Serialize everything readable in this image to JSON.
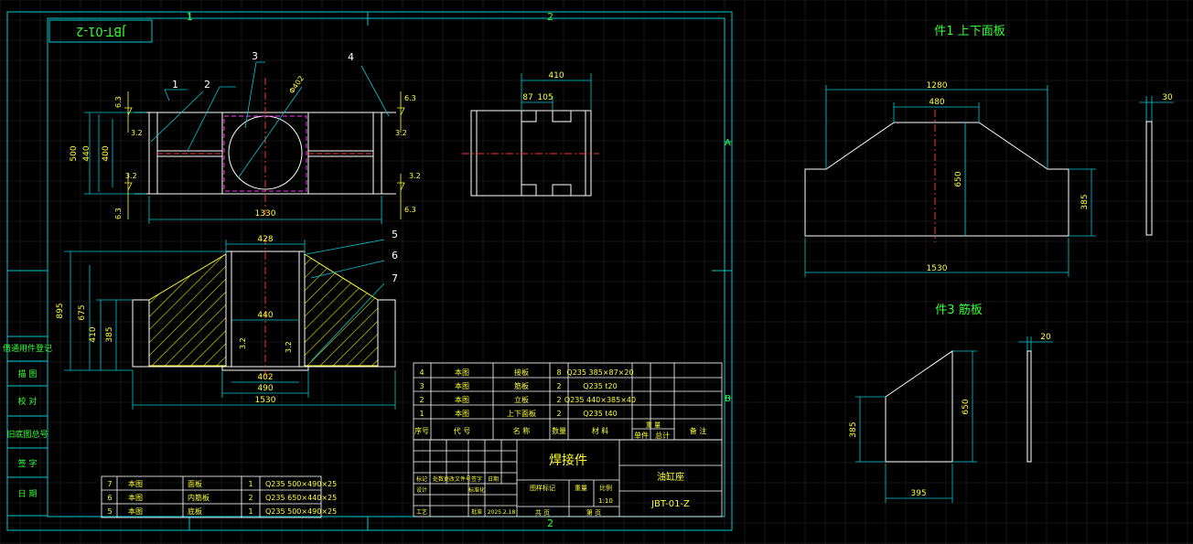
{
  "colors": {
    "background": "#000000",
    "grid": "#2a2a2a",
    "frame": "#00c8d6",
    "outline": "#ffffff",
    "text_green": "#33ff33",
    "text_yellow": "#ffff33",
    "hatch": "#e6e600",
    "centerline": "#ff3333",
    "magenta": "#ff33ff"
  },
  "sheet": {
    "zone_top_1": "1",
    "zone_top_2": "2",
    "zone_bottom_2": "2",
    "zone_right_a": "A",
    "zone_right_b": "B",
    "code_mirrored": "JBT-01-2"
  },
  "side_labels": [
    "借通用件登记",
    "描 图",
    "校 对",
    "旧底图总号",
    "签 字",
    "日 期"
  ],
  "top_view": {
    "dims": {
      "d500": "500",
      "d440": "440",
      "d400": "400",
      "d1330": "1330",
      "phi": "Φ402"
    },
    "weld_marks": [
      "6.3",
      "3.2",
      "3.2",
      "6.3",
      "6.3",
      "3.2",
      "3.2",
      "6.3"
    ],
    "callouts": [
      "1",
      "2",
      "3",
      "4"
    ]
  },
  "side_view": {
    "dims": {
      "d410": "410",
      "d87": "87",
      "d105": "105"
    }
  },
  "front_view": {
    "dims": {
      "d428": "428",
      "d895": "895",
      "d675": "675",
      "d410": "410",
      "d385": "385",
      "d440": "440",
      "d402": "402",
      "d490": "490",
      "d1530": "1530"
    },
    "weld_marks": [
      "3.2",
      "3.2"
    ],
    "callouts": [
      "5",
      "6",
      "7"
    ]
  },
  "part1": {
    "title": "件1 上下面板",
    "dims": {
      "d1280": "1280",
      "d480": "480",
      "d650": "650",
      "d385": "385",
      "d1530": "1530",
      "d30": "30"
    }
  },
  "part3": {
    "title": "件3 筋板",
    "dims": {
      "d385": "385",
      "d650": "650",
      "d395": "395",
      "d20": "20"
    }
  },
  "bom_upper": {
    "rows": [
      [
        "4",
        "本图",
        "接板",
        "8",
        "Q235 385×87×20"
      ],
      [
        "3",
        "本图",
        "筋板",
        "2",
        "Q235 t20"
      ],
      [
        "2",
        "本图",
        "立板",
        "2",
        "Q235 440×385×40"
      ],
      [
        "1",
        "本图",
        "上下面板",
        "2",
        "Q235 t40"
      ]
    ],
    "headers": [
      "序号",
      "代 号",
      "名 称",
      "数量",
      "材 料",
      "单件",
      "总计",
      "备 注"
    ],
    "weight_header": "重 量"
  },
  "bom_lower": {
    "rows": [
      [
        "7",
        "本图",
        "面板",
        "1",
        "Q235 500×490×25"
      ],
      [
        "6",
        "本图",
        "内筋板",
        "2",
        "Q235 650×440×25"
      ],
      [
        "5",
        "本图",
        "底板",
        "1",
        "Q235 500×490×25"
      ]
    ]
  },
  "title_block": {
    "name": "焊接件",
    "part": "油缸座",
    "code": "JBT-01-Z",
    "row_labels": [
      "标记",
      "处数",
      "更改文件号",
      "签字",
      "日期"
    ],
    "design": "设计",
    "process": "工艺",
    "standard": "标准化",
    "approve": "批准",
    "date_label": "日期",
    "date_value": "2025.2.18",
    "stage": "图样标记",
    "weight": "重量",
    "scale": "比例",
    "scale_value": "1:10",
    "total": "共 页",
    "sheet": "第 页"
  }
}
